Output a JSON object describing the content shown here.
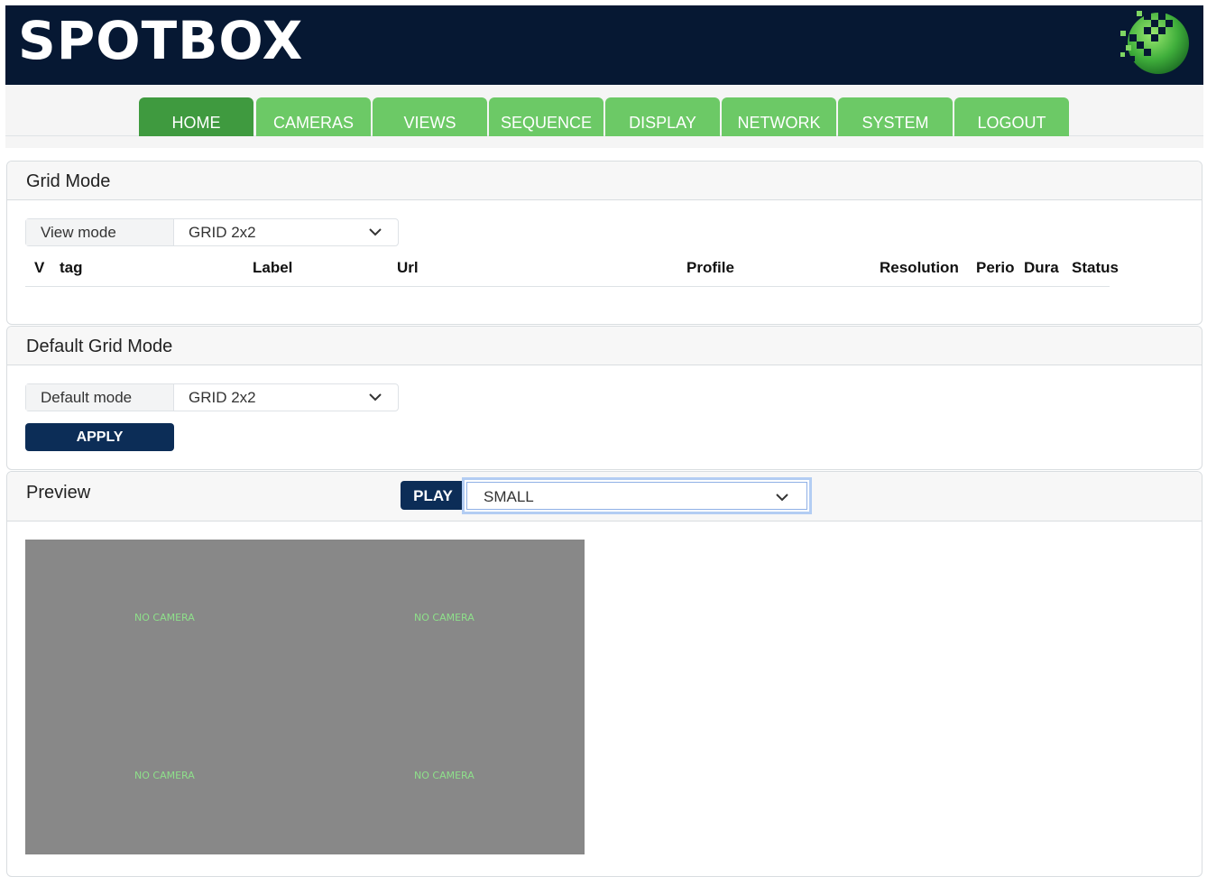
{
  "app": {
    "brand": "SPOTBOX",
    "logo_icon": "sphere-grid-logo-icon"
  },
  "nav": {
    "tabs": [
      {
        "label": "HOME",
        "active": true
      },
      {
        "label": "CAMERAS"
      },
      {
        "label": "VIEWS"
      },
      {
        "label": "SEQUENCE"
      },
      {
        "label": "DISPLAY"
      },
      {
        "label": "NETWORK"
      },
      {
        "label": "SYSTEM"
      },
      {
        "label": "LOGOUT"
      }
    ]
  },
  "grid_mode": {
    "title": "Grid Mode",
    "view_mode_label": "View mode",
    "view_mode_value": "GRID 2x2",
    "columns": [
      "V",
      "tag",
      "Label",
      "Url",
      "Profile",
      "Resolution",
      "Perio",
      "Dura",
      "Status"
    ]
  },
  "default_grid_mode": {
    "title": "Default Grid Mode",
    "default_mode_label": "Default mode",
    "default_mode_value": "GRID 2x2",
    "apply_label": "APPLY"
  },
  "preview": {
    "title": "Preview",
    "play_label": "PLAY",
    "size_value": "SMALL",
    "cells": [
      "NO CAMERA",
      "NO CAMERA",
      "NO CAMERA",
      "NO CAMERA"
    ]
  },
  "colors": {
    "header_bg": "#061833",
    "tab_bg": "#6cc966",
    "tab_active_bg": "#3f9a3f",
    "button_bg": "#0c2d57",
    "preview_bg": "#888888",
    "no_camera_text": "#8ee08a"
  }
}
